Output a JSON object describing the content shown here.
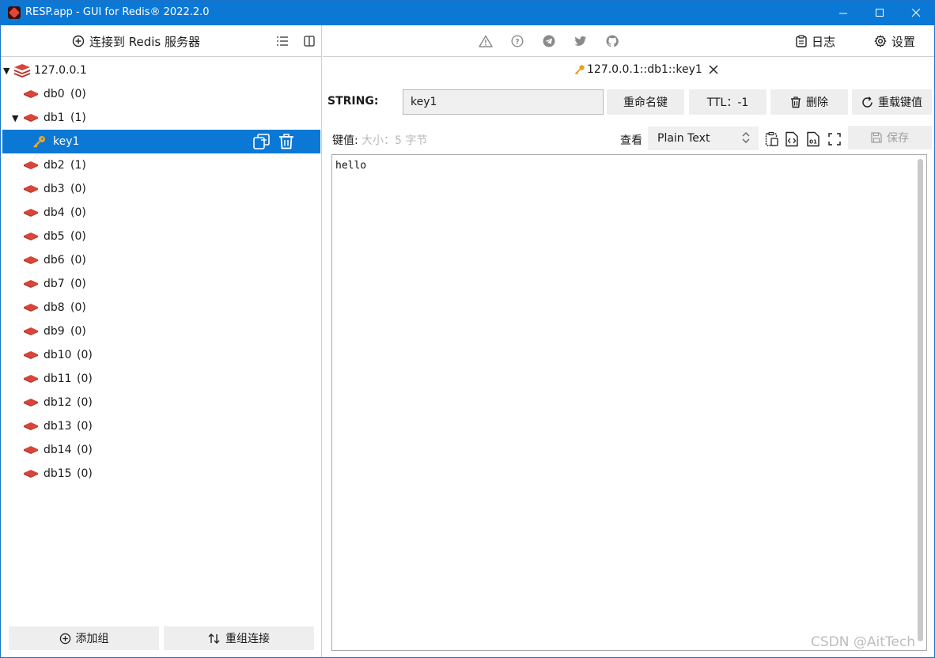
{
  "window": {
    "title": "RESP.app - GUI for Redis® 2022.2.0"
  },
  "left_header": {
    "connect_label": "连接到 Redis 服务器"
  },
  "tree": {
    "server": "127.0.0.1",
    "selected_key": "key1",
    "databases": [
      {
        "name": "db0",
        "count": "(0)"
      },
      {
        "name": "db1",
        "count": "(1)"
      },
      {
        "name": "db2",
        "count": "(1)"
      },
      {
        "name": "db3",
        "count": "(0)"
      },
      {
        "name": "db4",
        "count": "(0)"
      },
      {
        "name": "db5",
        "count": "(0)"
      },
      {
        "name": "db6",
        "count": "(0)"
      },
      {
        "name": "db7",
        "count": "(0)"
      },
      {
        "name": "db8",
        "count": "(0)"
      },
      {
        "name": "db9",
        "count": "(0)"
      },
      {
        "name": "db10",
        "count": "(0)"
      },
      {
        "name": "db11",
        "count": "(0)"
      },
      {
        "name": "db12",
        "count": "(0)"
      },
      {
        "name": "db13",
        "count": "(0)"
      },
      {
        "name": "db14",
        "count": "(0)"
      },
      {
        "name": "db15",
        "count": "(0)"
      }
    ]
  },
  "left_footer": {
    "add_group": "添加组",
    "regroup": "重组连接"
  },
  "toolbar": {
    "log_label": "日志",
    "settings_label": "设置"
  },
  "tab": {
    "label": "127.0.0.1::db1::key1"
  },
  "key_panel": {
    "type": "STRING:",
    "key_name": "key1",
    "rename": "重命名键",
    "ttl": "TTL：-1",
    "delete": "删除",
    "reload": "重载键值"
  },
  "value_panel": {
    "label": "键值:",
    "size": "大小：5 字节",
    "view_label": "查看",
    "view_mode": "Plain Text",
    "save": "保存",
    "content": "hello"
  },
  "watermark": "CSDN @AitTech",
  "colors": {
    "titlebar": "#0b78d6",
    "selection": "#0b78d6",
    "db_icon": "#d9443a",
    "key_icon": "#e8a21a"
  }
}
